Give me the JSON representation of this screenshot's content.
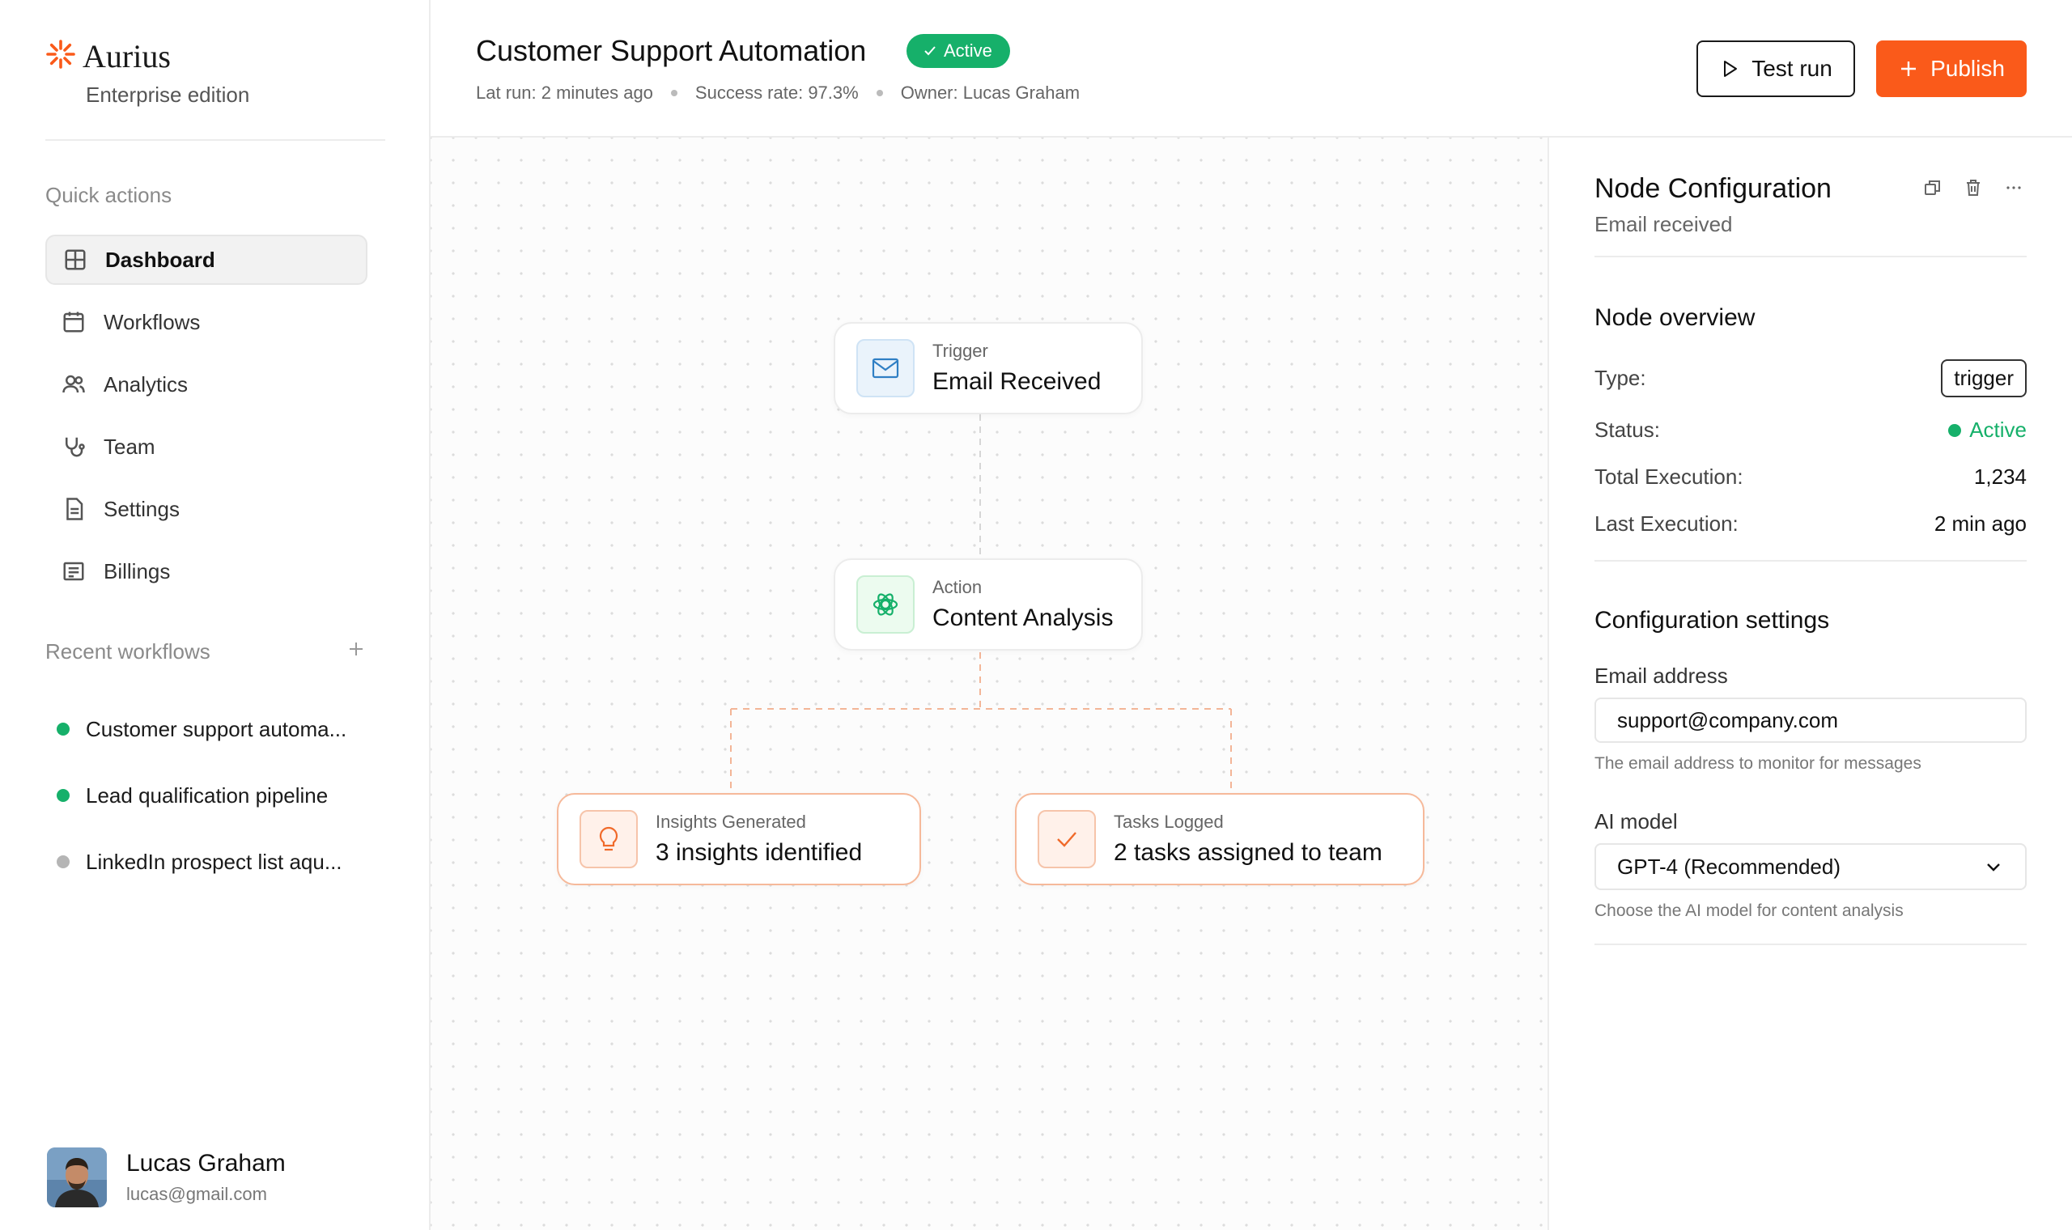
{
  "brand": {
    "name": "Aurius",
    "edition": "Enterprise edition",
    "accent": "#fa5a1a"
  },
  "sidebar": {
    "quick_actions_label": "Quick actions",
    "items": [
      {
        "label": "Dashboard",
        "icon": "grid-icon",
        "active": true
      },
      {
        "label": "Workflows",
        "icon": "calendar-icon",
        "active": false
      },
      {
        "label": "Analytics",
        "icon": "users-icon",
        "active": false
      },
      {
        "label": "Team",
        "icon": "stethoscope-icon",
        "active": false
      },
      {
        "label": "Settings",
        "icon": "document-icon",
        "active": false
      },
      {
        "label": "Billings",
        "icon": "receipt-icon",
        "active": false
      }
    ],
    "recent_label": "Recent workflows",
    "recent": [
      {
        "label": "Customer support automa...",
        "status_color": "#16b06a"
      },
      {
        "label": "Lead qualification pipeline",
        "status_color": "#16b06a"
      },
      {
        "label": "LinkedIn prospect list aqu...",
        "status_color": "#b5b5b5"
      }
    ]
  },
  "user": {
    "name": "Lucas Graham",
    "email": "lucas@gmail.com"
  },
  "header": {
    "title": "Customer Support Automation",
    "status": "Active",
    "last_run": "Lat run: 2 minutes ago",
    "success_rate": "Success rate: 97.3%",
    "owner": "Owner: Lucas Graham",
    "test_run_label": "Test run",
    "publish_label": "Publish"
  },
  "nodes": {
    "trigger": {
      "label": "Trigger",
      "title": "Email Received"
    },
    "action": {
      "label": "Action",
      "title": "Content Analysis"
    },
    "insights": {
      "label": "Insights Generated",
      "title": "3 insights identified"
    },
    "tasks": {
      "label": "Tasks Logged",
      "title": "2 tasks assigned to team"
    }
  },
  "panel": {
    "title": "Node Configuration",
    "subtitle": "Email received",
    "overview_heading": "Node overview",
    "type_key": "Type:",
    "type_value": "trigger",
    "status_key": "Status:",
    "status_value": "Active",
    "total_key": "Total Execution:",
    "total_value": "1,234",
    "last_key": "Last Execution:",
    "last_value": "2 min ago",
    "config_heading": "Configuration settings",
    "email_label": "Email address",
    "email_value": "support@company.com",
    "email_help": "The email address to monitor for messages",
    "model_label": "AI model",
    "model_value": "GPT-4 (Recommended)",
    "model_help": "Choose the AI model for content analysis"
  }
}
